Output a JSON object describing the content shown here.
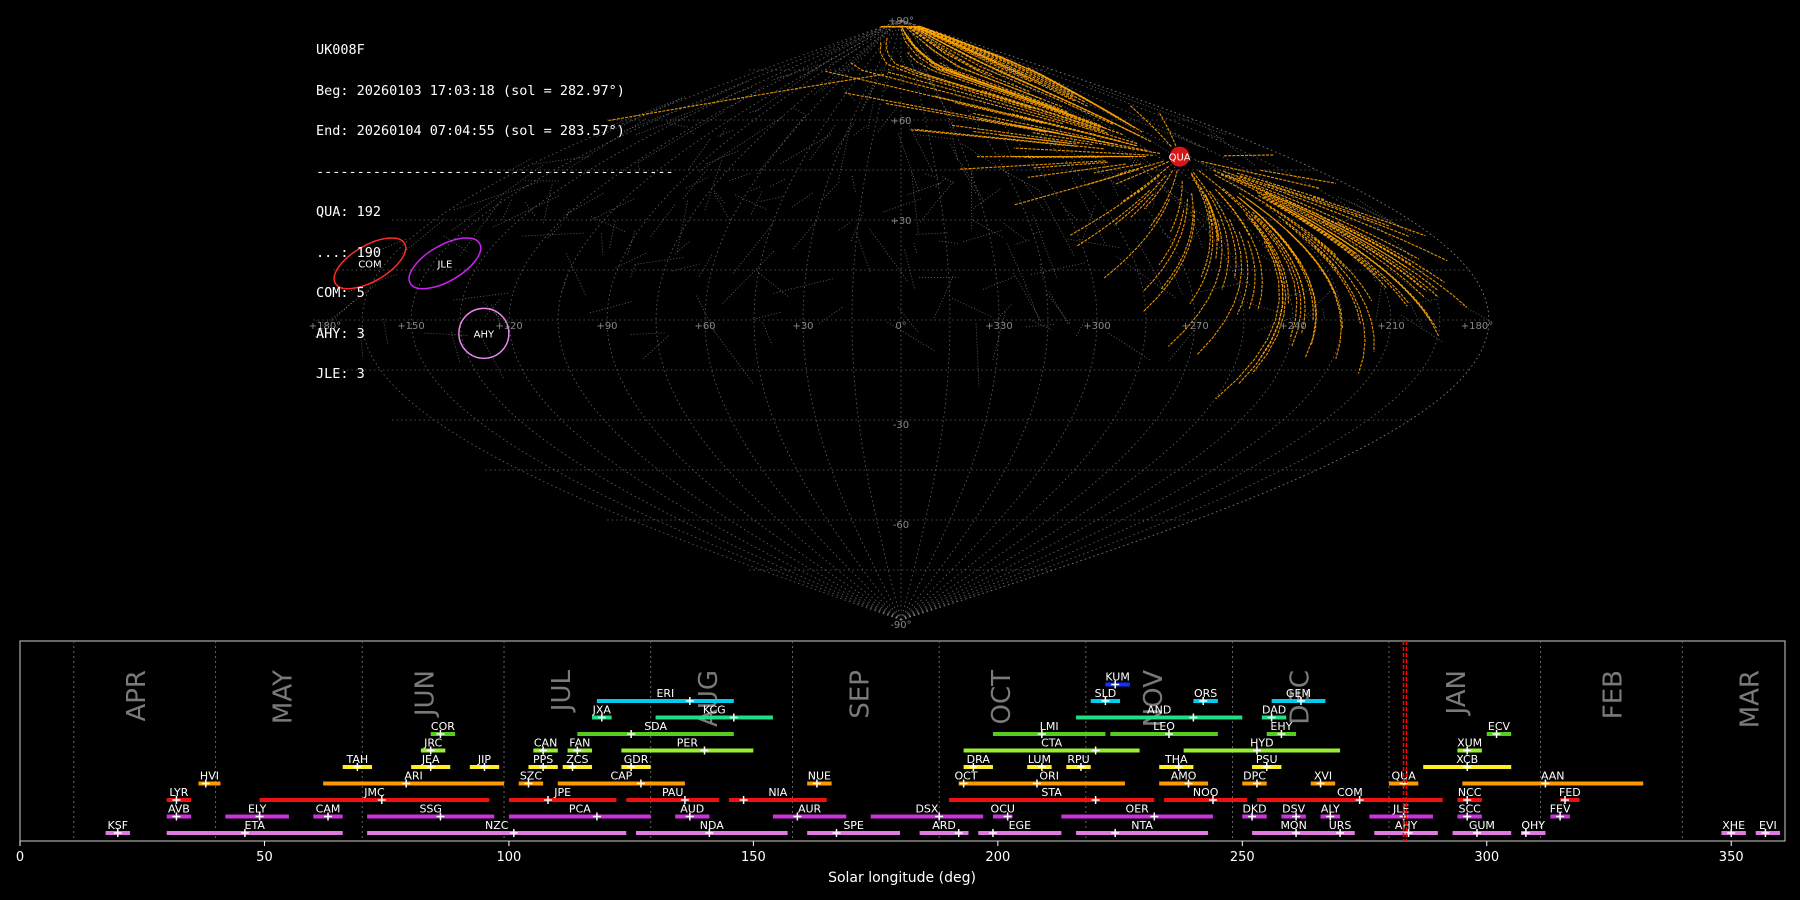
{
  "info": {
    "station": "UK008F",
    "begin": "Beg: 20260103 17:03:18 (sol = 282.97°)",
    "end": "End: 20260104 07:04:55 (sol = 283.57°)",
    "separator": "--------------------------------------------",
    "counts": [
      "QUA: 192",
      "...: 190",
      "COM: 5",
      "AHY: 3",
      "JLE: 3"
    ]
  },
  "colors": {
    "background": "#000000",
    "sporadic_trail": "#999999",
    "shower_trail": "#ffa500",
    "grid": "#888888",
    "QUA": "#ff1a1a",
    "COM": "#ff2a2a",
    "JLE": "#cc22ee",
    "AHY": "#ee88ee",
    "current_sol": "#ff0000",
    "axis_text": "#ffffff",
    "month_text": "#7a7a7a"
  },
  "chart_data": [
    {
      "type": "scatter",
      "projection": "sinusoidal (sky map, RA/Dec)",
      "lon_ticks": [
        "+180°",
        "+150",
        "+120",
        "+90",
        "+60",
        "+30",
        "0°",
        "+330",
        "+300",
        "+270",
        "+240",
        "+210",
        "+180°"
      ],
      "lat_ticks": [
        "+90°",
        "+60",
        "+30",
        "-30",
        "-60",
        "-90°"
      ],
      "showers": [
        {
          "code": "QUA",
          "ra": 230,
          "dec": 49,
          "count": 192,
          "color": "#ff1a1a"
        },
        {
          "code": "COM",
          "ra": 170,
          "dec": 17,
          "count": 5,
          "color": "#ff2a2a"
        },
        {
          "code": "JLE",
          "ra": 146,
          "dec": 17,
          "count": 3,
          "color": "#cc22ee"
        },
        {
          "code": "AHY",
          "ra": 128,
          "dec": -4,
          "count": 3,
          "color": "#ee88ee"
        }
      ],
      "grid": true
    },
    {
      "type": "bar",
      "subtype": "shower activity timeline",
      "xlabel": "Solar longitude (deg)",
      "xlim": [
        0,
        361
      ],
      "xticks": [
        0,
        50,
        100,
        150,
        200,
        250,
        300,
        350
      ],
      "current_sol": [
        282.97,
        283.57
      ],
      "months": [
        {
          "name": "APR",
          "start": 11,
          "label": 24
        },
        {
          "name": "MAY",
          "start": 40,
          "label": 54
        },
        {
          "name": "JUN",
          "start": 70,
          "label": 83
        },
        {
          "name": "JUL",
          "start": 99,
          "label": 111
        },
        {
          "name": "AUG",
          "start": 129,
          "label": 141
        },
        {
          "name": "SEP",
          "start": 158,
          "label": 172
        },
        {
          "name": "OCT",
          "start": 188,
          "label": 201
        },
        {
          "name": "NOV",
          "start": 218,
          "label": 232
        },
        {
          "name": "DEC",
          "start": 248,
          "label": 262
        },
        {
          "name": "JAN",
          "start": 280,
          "label": 294
        },
        {
          "name": "FEB",
          "start": 311,
          "label": 326
        },
        {
          "name": "MAR",
          "start": 340,
          "label": 354
        }
      ],
      "showers": [
        {
          "code": "KSF",
          "start": 17.5,
          "end": 22.5,
          "peak": 20,
          "level": 0,
          "color": "#e07ae0"
        },
        {
          "code": "ETA",
          "start": 30,
          "end": 66,
          "peak": 46,
          "level": 0,
          "color": "#e07ae0"
        },
        {
          "code": "NZC",
          "start": 71,
          "end": 124,
          "peak": 101,
          "level": 0,
          "color": "#e07ae0"
        },
        {
          "code": "NDA",
          "start": 126,
          "end": 157,
          "peak": 141,
          "level": 0,
          "color": "#e07ae0"
        },
        {
          "code": "SPE",
          "start": 161,
          "end": 180,
          "peak": 167,
          "level": 0,
          "color": "#e07ae0"
        },
        {
          "code": "ARD",
          "start": 184,
          "end": 194,
          "peak": 192,
          "level": 0,
          "color": "#e07ae0"
        },
        {
          "code": "EGE",
          "start": 196,
          "end": 213,
          "peak": 199,
          "level": 0,
          "color": "#e07ae0"
        },
        {
          "code": "NTA",
          "start": 216,
          "end": 243,
          "peak": 224,
          "level": 0,
          "color": "#e07ae0"
        },
        {
          "code": "MON",
          "start": 252,
          "end": 269,
          "peak": 261,
          "level": 0,
          "color": "#e07ae0"
        },
        {
          "code": "URS",
          "start": 267,
          "end": 273,
          "peak": 270,
          "level": 0,
          "color": "#e07ae0"
        },
        {
          "code": "AHY",
          "start": 277,
          "end": 290,
          "peak": 284,
          "level": 0,
          "color": "#e07ae0"
        },
        {
          "code": "GUM",
          "start": 293,
          "end": 305,
          "peak": 298,
          "level": 0,
          "color": "#e07ae0"
        },
        {
          "code": "OHY",
          "start": 307,
          "end": 312,
          "peak": 308,
          "level": 0,
          "color": "#e07ae0"
        },
        {
          "code": "XHE",
          "start": 348,
          "end": 353,
          "peak": 350,
          "level": 0,
          "color": "#e07ae0"
        },
        {
          "code": "EVI",
          "start": 355,
          "end": 360,
          "peak": 357,
          "level": 0,
          "color": "#e07ae0"
        },
        {
          "code": "AVB",
          "start": 30,
          "end": 35,
          "peak": 32,
          "level": 1,
          "color": "#cc33dd"
        },
        {
          "code": "ELY",
          "start": 42,
          "end": 55,
          "peak": 49,
          "level": 1,
          "color": "#cc33dd"
        },
        {
          "code": "CAM",
          "start": 60,
          "end": 66,
          "peak": 63,
          "level": 1,
          "color": "#cc33dd"
        },
        {
          "code": "SSG",
          "start": 71,
          "end": 97,
          "peak": 86,
          "level": 1,
          "color": "#cc33dd"
        },
        {
          "code": "PCA",
          "start": 100,
          "end": 129,
          "peak": 118,
          "level": 1,
          "color": "#cc33dd"
        },
        {
          "code": "AUD",
          "start": 134,
          "end": 141,
          "peak": 137,
          "level": 1,
          "color": "#cc33dd"
        },
        {
          "code": "AUR",
          "start": 154,
          "end": 169,
          "peak": 159,
          "level": 1,
          "color": "#cc33dd"
        },
        {
          "code": "DSX",
          "start": 174,
          "end": 197,
          "peak": 188,
          "level": 1,
          "color": "#cc33dd"
        },
        {
          "code": "OCU",
          "start": 199,
          "end": 203,
          "peak": 202,
          "level": 1,
          "color": "#cc33dd"
        },
        {
          "code": "OER",
          "start": 213,
          "end": 244,
          "peak": 232,
          "level": 1,
          "color": "#cc33dd"
        },
        {
          "code": "DKD",
          "start": 250,
          "end": 255,
          "peak": 252,
          "level": 1,
          "color": "#cc33dd"
        },
        {
          "code": "DSV",
          "start": 258,
          "end": 263,
          "peak": 261,
          "level": 1,
          "color": "#cc33dd"
        },
        {
          "code": "ALY",
          "start": 266,
          "end": 270,
          "peak": 268,
          "level": 1,
          "color": "#cc33dd"
        },
        {
          "code": "JLE",
          "start": 276,
          "end": 289,
          "peak": 283,
          "level": 1,
          "color": "#cc33dd"
        },
        {
          "code": "SCC",
          "start": 294,
          "end": 299,
          "peak": 296,
          "level": 1,
          "color": "#cc33dd"
        },
        {
          "code": "FEV",
          "start": 313,
          "end": 317,
          "peak": 315,
          "level": 1,
          "color": "#cc33dd"
        },
        {
          "code": "LYR",
          "start": 30,
          "end": 35,
          "peak": 32,
          "level": 2,
          "color": "#ee1111"
        },
        {
          "code": "JMC",
          "start": 49,
          "end": 96,
          "peak": 74,
          "level": 2,
          "color": "#ee1111"
        },
        {
          "code": "JPE",
          "start": 100,
          "end": 122,
          "peak": 108,
          "level": 2,
          "color": "#ee1111"
        },
        {
          "code": "PAU",
          "start": 124,
          "end": 143,
          "peak": 136,
          "level": 2,
          "color": "#ee1111"
        },
        {
          "code": "NIA",
          "start": 145,
          "end": 165,
          "peak": 148,
          "level": 2,
          "color": "#ee1111"
        },
        {
          "code": "STA",
          "start": 190,
          "end": 232,
          "peak": 220,
          "level": 2,
          "color": "#ee1111"
        },
        {
          "code": "NOO",
          "start": 234,
          "end": 251,
          "peak": 244,
          "level": 2,
          "color": "#ee1111"
        },
        {
          "code": "COM",
          "start": 253,
          "end": 291,
          "peak": 274,
          "level": 2,
          "color": "#ee1111"
        },
        {
          "code": "NCC",
          "start": 294,
          "end": 299,
          "peak": 296,
          "level": 2,
          "color": "#ee1111"
        },
        {
          "code": "FED",
          "start": 315,
          "end": 319,
          "peak": 316,
          "level": 2,
          "color": "#ee1111"
        },
        {
          "code": "HVI",
          "start": 36.5,
          "end": 41,
          "peak": 38,
          "level": 3,
          "color": "#ff9900"
        },
        {
          "code": "ARI",
          "start": 62,
          "end": 99,
          "peak": 79,
          "level": 3,
          "color": "#ff9900"
        },
        {
          "code": "SZC",
          "start": 102,
          "end": 107,
          "peak": 104,
          "level": 3,
          "color": "#ff9900"
        },
        {
          "code": "CAP",
          "start": 110,
          "end": 136,
          "peak": 127,
          "level": 3,
          "color": "#ff9900"
        },
        {
          "code": "NUE",
          "start": 161,
          "end": 166,
          "peak": 163,
          "level": 3,
          "color": "#ff9900"
        },
        {
          "code": "OCT",
          "start": 192,
          "end": 195,
          "peak": 193,
          "level": 3,
          "color": "#ff9900"
        },
        {
          "code": "ORI",
          "start": 195,
          "end": 226,
          "peak": 208,
          "level": 3,
          "color": "#ff9900"
        },
        {
          "code": "AMO",
          "start": 233,
          "end": 243,
          "peak": 239,
          "level": 3,
          "color": "#ff9900"
        },
        {
          "code": "DPC",
          "start": 250,
          "end": 255,
          "peak": 253,
          "level": 3,
          "color": "#ff9900"
        },
        {
          "code": "XVI",
          "start": 264,
          "end": 269,
          "peak": 266,
          "level": 3,
          "color": "#ff9900"
        },
        {
          "code": "QUA",
          "start": 280,
          "end": 286,
          "peak": 283,
          "level": 3,
          "color": "#ff9900"
        },
        {
          "code": "AAN",
          "start": 295,
          "end": 332,
          "peak": 312,
          "level": 3,
          "color": "#ff9900"
        },
        {
          "code": "TAH",
          "start": 66,
          "end": 72,
          "peak": 69,
          "level": 4,
          "color": "#ffee22"
        },
        {
          "code": "JEA",
          "start": 80,
          "end": 88,
          "peak": 84,
          "level": 4,
          "color": "#ffee22"
        },
        {
          "code": "JIP",
          "start": 92,
          "end": 98,
          "peak": 95,
          "level": 4,
          "color": "#ffee22"
        },
        {
          "code": "PPS",
          "start": 104,
          "end": 110,
          "peak": 107,
          "level": 4,
          "color": "#ffee22"
        },
        {
          "code": "ZCS",
          "start": 111,
          "end": 117,
          "peak": 113,
          "level": 4,
          "color": "#ffee22"
        },
        {
          "code": "GDR",
          "start": 123,
          "end": 129,
          "peak": 125,
          "level": 4,
          "color": "#ffee22"
        },
        {
          "code": "DRA",
          "start": 193,
          "end": 199,
          "peak": 195,
          "level": 4,
          "color": "#ffee22"
        },
        {
          "code": "LUM",
          "start": 206,
          "end": 211,
          "peak": 209,
          "level": 4,
          "color": "#ffee22"
        },
        {
          "code": "RPU",
          "start": 214,
          "end": 219,
          "peak": 217,
          "level": 4,
          "color": "#ffee22"
        },
        {
          "code": "THA",
          "start": 233,
          "end": 240,
          "peak": 237,
          "level": 4,
          "color": "#ffee22"
        },
        {
          "code": "PSU",
          "start": 252,
          "end": 258,
          "peak": 255,
          "level": 4,
          "color": "#ffee22"
        },
        {
          "code": "XCB",
          "start": 287,
          "end": 305,
          "peak": 296,
          "level": 4,
          "color": "#ffee22"
        },
        {
          "code": "JRC",
          "start": 82,
          "end": 87,
          "peak": 84,
          "level": 5,
          "color": "#99ee33"
        },
        {
          "code": "CAN",
          "start": 105,
          "end": 110,
          "peak": 107,
          "level": 5,
          "color": "#99ee33"
        },
        {
          "code": "FAN",
          "start": 112,
          "end": 117,
          "peak": 114,
          "level": 5,
          "color": "#99ee33"
        },
        {
          "code": "PER",
          "start": 123,
          "end": 150,
          "peak": 140,
          "level": 5,
          "color": "#99ee33"
        },
        {
          "code": "CTA",
          "start": 193,
          "end": 229,
          "peak": 220,
          "level": 5,
          "color": "#99ee33"
        },
        {
          "code": "HYD",
          "start": 238,
          "end": 270,
          "peak": 253,
          "level": 5,
          "color": "#99ee33"
        },
        {
          "code": "XUM",
          "start": 294,
          "end": 299,
          "peak": 296,
          "level": 5,
          "color": "#99ee33"
        },
        {
          "code": "COR",
          "start": 84,
          "end": 89,
          "peak": 86,
          "level": 6,
          "color": "#55cc22"
        },
        {
          "code": "SDA",
          "start": 114,
          "end": 146,
          "peak": 125,
          "level": 6,
          "color": "#55cc22"
        },
        {
          "code": "LMI",
          "start": 199,
          "end": 222,
          "peak": 209,
          "level": 6,
          "color": "#55cc22"
        },
        {
          "code": "LEO",
          "start": 223,
          "end": 245,
          "peak": 235,
          "level": 6,
          "color": "#55cc22"
        },
        {
          "code": "EHY",
          "start": 255,
          "end": 261,
          "peak": 258,
          "level": 6,
          "color": "#55cc22"
        },
        {
          "code": "ECV",
          "start": 300,
          "end": 305,
          "peak": 302,
          "level": 6,
          "color": "#55cc22"
        },
        {
          "code": "JXA",
          "start": 117,
          "end": 121,
          "peak": 119,
          "level": 7,
          "color": "#22dd88"
        },
        {
          "code": "KCG",
          "start": 130,
          "end": 154,
          "peak": 146,
          "level": 7,
          "color": "#22dd88"
        },
        {
          "code": "AND",
          "start": 216,
          "end": 250,
          "peak": 240,
          "level": 7,
          "color": "#22dd88"
        },
        {
          "code": "DAD",
          "start": 254,
          "end": 259,
          "peak": 256,
          "level": 7,
          "color": "#22dd88"
        },
        {
          "code": "ERI",
          "start": 118,
          "end": 146,
          "peak": 137,
          "level": 8,
          "color": "#00ccee"
        },
        {
          "code": "SLD",
          "start": 219,
          "end": 225,
          "peak": 222,
          "level": 8,
          "color": "#00ccee"
        },
        {
          "code": "ORS",
          "start": 240,
          "end": 245,
          "peak": 242,
          "level": 8,
          "color": "#00ccee"
        },
        {
          "code": "GEM",
          "start": 256,
          "end": 267,
          "peak": 262,
          "level": 8,
          "color": "#00ccee"
        },
        {
          "code": "KUM",
          "start": 222,
          "end": 227,
          "peak": 224,
          "level": 9,
          "color": "#1133ff"
        }
      ]
    }
  ]
}
